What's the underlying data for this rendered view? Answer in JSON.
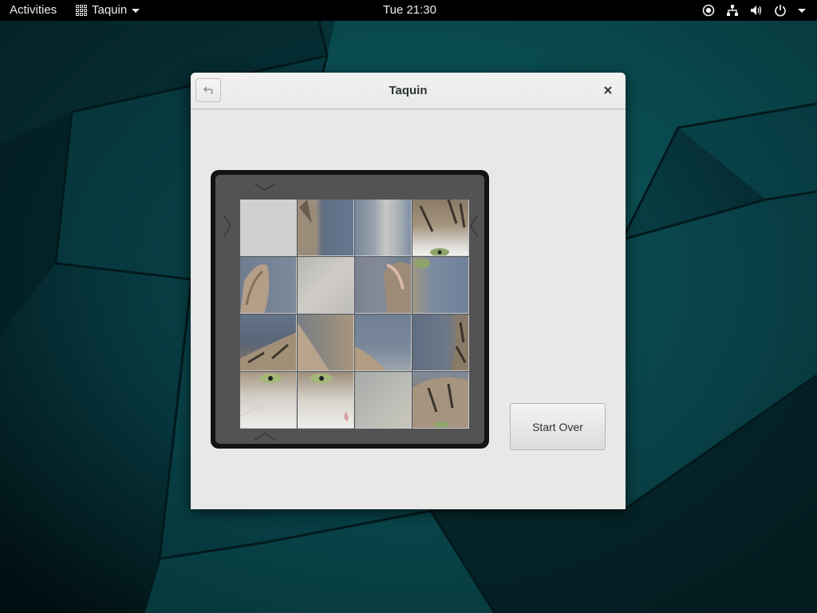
{
  "topbar": {
    "activities": "Activities",
    "app_name": "Taquin",
    "clock": "Tue 21:30",
    "tray_icons": [
      "accessibility-icon",
      "network-icon",
      "volume-icon",
      "power-icon",
      "system-menu-caret"
    ]
  },
  "window": {
    "title": "Taquin",
    "back_icon": "undo-arrow-icon",
    "close_icon": "close-icon",
    "start_over_label": "Start Over"
  },
  "puzzle": {
    "rows": 4,
    "cols": 4,
    "empty_tile": [
      0,
      0
    ],
    "image_subject": "cat",
    "arrows": [
      "up-arrow-top",
      "left-arrow",
      "right-arrow",
      "down-arrow-bottom"
    ]
  },
  "colors": {
    "wallpaper_accent": "#0f6a6c",
    "board_frame": "#131313",
    "board_inner": "#535353",
    "empty_tile": "#d0d0d0"
  }
}
